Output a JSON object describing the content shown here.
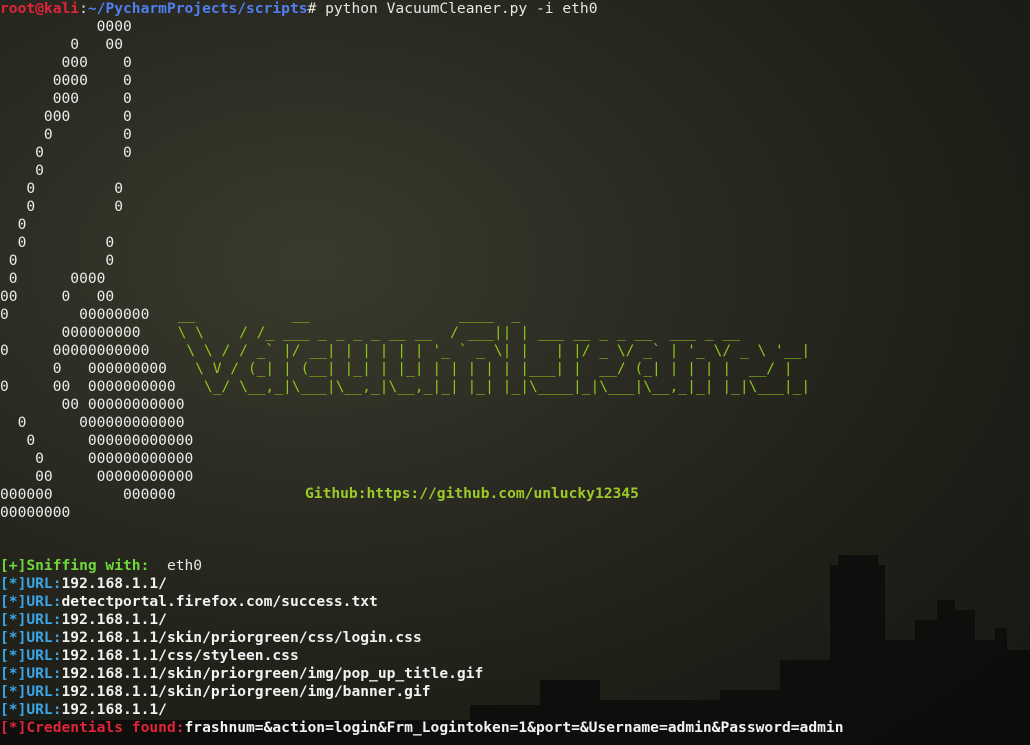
{
  "prompt": {
    "user_host": "root@kali",
    "separator": ":",
    "path": "~/PycharmProjects/scripts",
    "symbol": "#",
    "command": " python VacuumCleaner.py -i eth0"
  },
  "art_lines": [
    "           0000",
    "        0   00",
    "       000    0",
    "      0000    0",
    "      000     0",
    "     000      0",
    "     0        0",
    "    0         0",
    "    0",
    "   0         0",
    "   0         0",
    "  0",
    "  0         0",
    " 0          0",
    " 0      0000",
    "00     0   00",
    "0        00000000",
    "       000000000",
    "0     00000000000",
    "      0   000000000",
    "0     00  0000000000",
    "       00 00000000000",
    "  0      000000000000",
    "   0      000000000000",
    "    0     000000000000",
    "    00     00000000000",
    "000000        000000",
    "00000000"
  ],
  "logo_lines": [
    "  __           __                 ____  _",
    "  \\ \\    / /_ ___ _ _ _ _ __ __  / ___|| | ___ __ _ _ __  ___ _ __",
    "   \\ \\ / / _` |/ __| | | | | | '_ ` _ \\| |   | |/ _ \\/ _` | '_ \\/ _ \\ '__|",
    "    \\ V / (_| | (__| |_| | |_| | | | | | |___| |  __/ (_| | | | |  __/ |",
    "     \\_/ \\__,_|\\___|\\__,_|\\__,_|_| |_| |_|\\____|_|\\___|\\__,_|_| |_|\\___|_|"
  ],
  "github_text": "Github:https://github.com/unlucky12345",
  "log": [
    {
      "tag": "[+]",
      "label": "Sniffing with:",
      "value": "  eth0",
      "kind": "sniff"
    },
    {
      "tag": "[*]",
      "label": "URL:",
      "value": "192.168.1.1/",
      "kind": "url"
    },
    {
      "tag": "[*]",
      "label": "URL:",
      "value": "detectportal.firefox.com/success.txt",
      "kind": "url"
    },
    {
      "tag": "[*]",
      "label": "URL:",
      "value": "192.168.1.1/",
      "kind": "url"
    },
    {
      "tag": "[*]",
      "label": "URL:",
      "value": "192.168.1.1/skin/priorgreen/css/login.css",
      "kind": "url"
    },
    {
      "tag": "[*]",
      "label": "URL:",
      "value": "192.168.1.1/css/styleen.css",
      "kind": "url"
    },
    {
      "tag": "[*]",
      "label": "URL:",
      "value": "192.168.1.1/skin/priorgreen/img/pop_up_title.gif",
      "kind": "url"
    },
    {
      "tag": "[*]",
      "label": "URL:",
      "value": "192.168.1.1/skin/priorgreen/img/banner.gif",
      "kind": "url"
    },
    {
      "tag": "[*]",
      "label": "URL:",
      "value": "192.168.1.1/",
      "kind": "url"
    },
    {
      "tag": "[*]",
      "label": "Credentials found:",
      "value": "frashnum=&action=login&Frm_Logintoken=1&port=&Username=admin&Password=admin",
      "kind": "cred"
    }
  ]
}
